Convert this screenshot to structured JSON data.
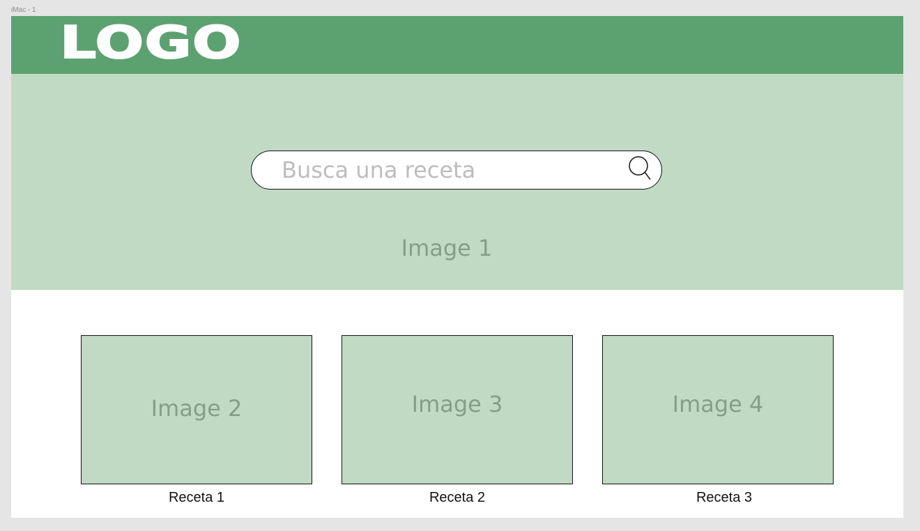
{
  "frame": {
    "label": "iMac - 1"
  },
  "header": {
    "logo_text": "LOGO",
    "background_color": "#5ca270"
  },
  "hero": {
    "background_color": "#c1dac4",
    "search": {
      "placeholder": "Busca una receta",
      "icon": "search-icon"
    },
    "image_label": "Image 1"
  },
  "recipes": [
    {
      "image_label": "Image 2",
      "title": "Receta 1"
    },
    {
      "image_label": "Image 3",
      "title": "Receta 2"
    },
    {
      "image_label": "Image 4",
      "title": "Receta 3"
    }
  ]
}
